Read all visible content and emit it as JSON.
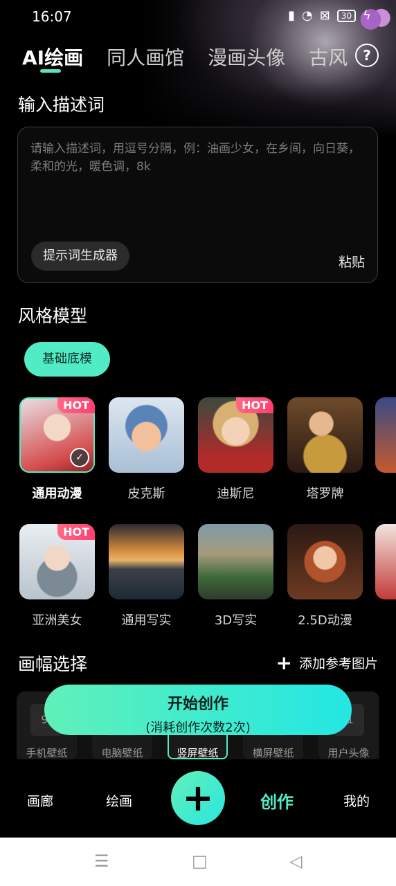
{
  "status": {
    "time": "16:07",
    "battery": "30"
  },
  "top_tabs": [
    "AI绘画",
    "同人画馆",
    "漫画头像",
    "古风"
  ],
  "prompt": {
    "title": "输入描述词",
    "placeholder": "请输入描述词，用逗号分隔，例：油画少女，在乡间，向日葵，柔和的光，暖色调，8k",
    "generator_label": "提示词生成器",
    "paste_label": "粘贴"
  },
  "style": {
    "title": "风格模型",
    "filter_label": "基础底模",
    "hot_label": "HOT",
    "row1": [
      "通用动漫",
      "皮克斯",
      "迪斯尼",
      "塔罗牌"
    ],
    "row2": [
      "亚洲美女",
      "通用写实",
      "3D写实",
      "2.5D动漫"
    ]
  },
  "canvas": {
    "title": "画幅选择",
    "add_ref_label": "添加参考图片",
    "ratios": [
      {
        "label": "手机壁纸",
        "ratio": "9:"
      },
      {
        "label": "电脑壁纸",
        "ratio": ""
      },
      {
        "label": "竖屏壁纸",
        "ratio": ""
      },
      {
        "label": "横屏壁纸",
        "ratio": ""
      },
      {
        "label": "用户头像",
        "ratio": ":1"
      }
    ]
  },
  "create": {
    "main": "开始创作",
    "sub": "(消耗创作次数2次)"
  },
  "nav": {
    "items": [
      "画廊",
      "绘画",
      "创作",
      "我的"
    ]
  },
  "colors": {
    "accent": "#51ECC5",
    "hot": "#FF3D71"
  }
}
